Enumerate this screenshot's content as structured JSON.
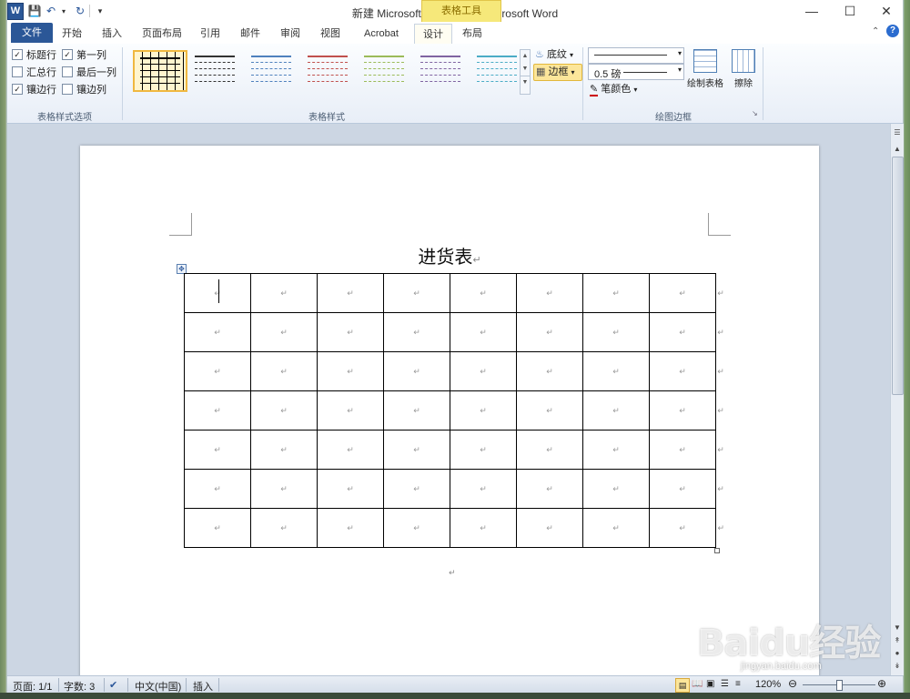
{
  "window": {
    "title": "新建 Microsoft Word 文档 - Microsoft Word",
    "context_tab_group": "表格工具",
    "qat_app_icon": "W"
  },
  "tabs": [
    {
      "label": "文件"
    },
    {
      "label": "开始"
    },
    {
      "label": "插入"
    },
    {
      "label": "页面布局"
    },
    {
      "label": "引用"
    },
    {
      "label": "邮件"
    },
    {
      "label": "审阅"
    },
    {
      "label": "视图"
    },
    {
      "label": "Acrobat"
    },
    {
      "label": "设计",
      "active": true
    },
    {
      "label": "布局"
    }
  ],
  "ribbon": {
    "style_options": {
      "label": "表格样式选项",
      "items": [
        {
          "label": "标题行",
          "checked": true
        },
        {
          "label": "第一列",
          "checked": true
        },
        {
          "label": "汇总行",
          "checked": false
        },
        {
          "label": "最后一列",
          "checked": false
        },
        {
          "label": "镶边行",
          "checked": true
        },
        {
          "label": "镶边列",
          "checked": false
        }
      ]
    },
    "table_styles": {
      "label": "表格样式",
      "thumb_colors": [
        "#000000",
        "#333333",
        "#4f81bd",
        "#c0504d",
        "#9bbb59",
        "#8064a2",
        "#4bacc6"
      ],
      "shading_label": "底纹",
      "borders_label": "边框"
    },
    "draw_borders": {
      "label": "绘图边框",
      "pen_weight": "0.5 磅",
      "pen_color_label": "笔颜色",
      "draw_table_label": "绘制表格",
      "eraser_label": "擦除"
    }
  },
  "document": {
    "title": "进货表",
    "paragraph_mark": "↵",
    "table_rows": 7,
    "table_cols": 8
  },
  "status": {
    "page": "页面: 1/1",
    "words": "字数: 3",
    "language": "中文(中国)",
    "mode": "插入",
    "zoom": "120%"
  },
  "watermark": {
    "brand": "Baidu经验",
    "url": "jingyan.baidu.com"
  }
}
